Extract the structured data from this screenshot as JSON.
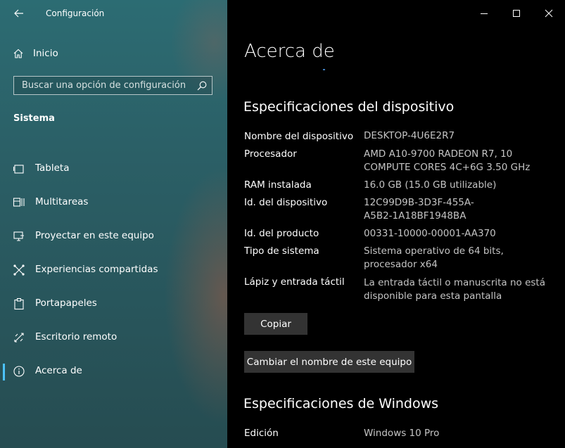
{
  "header": {
    "title": "Configuración"
  },
  "sidebar": {
    "home": "Inicio",
    "search_placeholder": "Buscar una opción de configuración",
    "section": "Sistema",
    "items": [
      {
        "label": "Tableta",
        "icon": "tablet-icon"
      },
      {
        "label": "Multitareas",
        "icon": "multitasking-icon"
      },
      {
        "label": "Proyectar en este equipo",
        "icon": "project-icon"
      },
      {
        "label": "Experiencias compartidas",
        "icon": "shared-experiences-icon"
      },
      {
        "label": "Portapapeles",
        "icon": "clipboard-icon"
      },
      {
        "label": "Escritorio remoto",
        "icon": "remote-desktop-icon"
      },
      {
        "label": "Acerca de",
        "icon": "info-icon",
        "selected": true
      }
    ]
  },
  "main": {
    "title": "Acerca de",
    "device_specs": {
      "heading": "Especificaciones del dispositivo",
      "rows": [
        {
          "label": "Nombre del dispositivo",
          "value": "DESKTOP-4U6E2R7"
        },
        {
          "label": "Procesador",
          "value": "AMD A10-9700 RADEON R7, 10 COMPUTE CORES 4C+6G    3.50 GHz"
        },
        {
          "label": "RAM instalada",
          "value": "16.0 GB (15.0 GB utilizable)"
        },
        {
          "label": "Id. del dispositivo",
          "value": "12C99D9B-3D3F-455A-A5B2-1A18BF1948BA"
        },
        {
          "label": "Id. del producto",
          "value": "00331-10000-00001-AA370"
        },
        {
          "label": "Tipo de sistema",
          "value": "Sistema operativo de 64 bits, procesador x64"
        },
        {
          "label": "Lápiz y entrada táctil",
          "value": "La entrada táctil o manuscrita no está disponible para esta pantalla"
        }
      ],
      "copy_button": "Copiar",
      "rename_button": "Cambiar el nombre de este equipo"
    },
    "windows_specs": {
      "heading": "Especificaciones de Windows",
      "rows": [
        {
          "label": "Edición",
          "value": "Windows 10 Pro"
        }
      ]
    }
  },
  "colors": {
    "accent": "#4cc2ff",
    "sidebar_bg": "#2b5f66",
    "button_bg": "#333333"
  }
}
